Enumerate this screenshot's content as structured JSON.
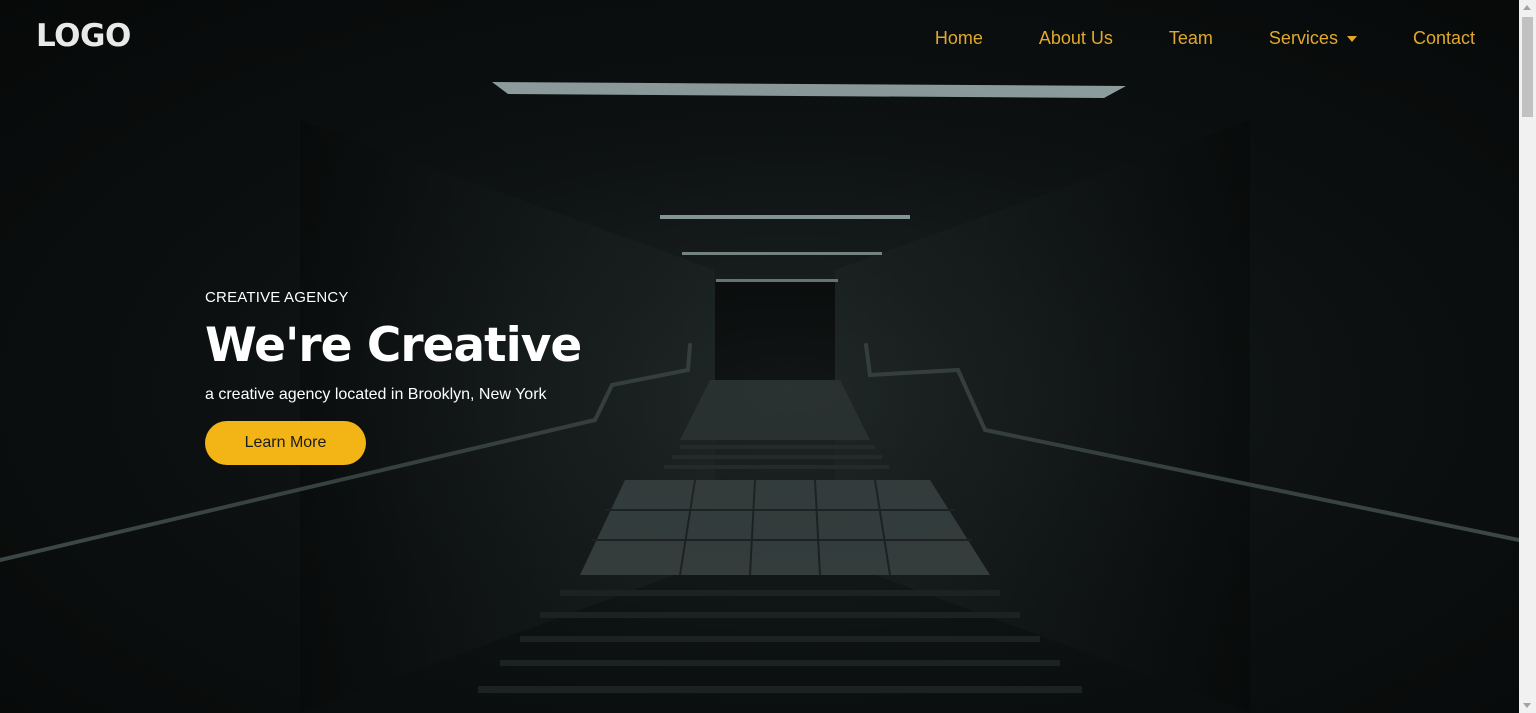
{
  "header": {
    "logo": "LOGO",
    "nav": [
      {
        "label": "Home",
        "has_dropdown": false
      },
      {
        "label": "About Us",
        "has_dropdown": false
      },
      {
        "label": "Team",
        "has_dropdown": false
      },
      {
        "label": "Services",
        "has_dropdown": true
      },
      {
        "label": "Contact",
        "has_dropdown": false
      }
    ]
  },
  "hero": {
    "eyebrow": "CREATIVE AGENCY",
    "headline": "We're Creative",
    "tagline": "a creative agency located in Brooklyn, New York",
    "cta_label": "Learn More",
    "background_image": "dark-stairwell-photo"
  },
  "colors": {
    "nav_link": "#e0a92c",
    "cta_background": "#f2b515",
    "cta_text": "#1c1c1c",
    "hero_text": "#ffffff",
    "background": "#0b0e0e"
  },
  "icons": {
    "services_dropdown": "caret-down-icon"
  }
}
